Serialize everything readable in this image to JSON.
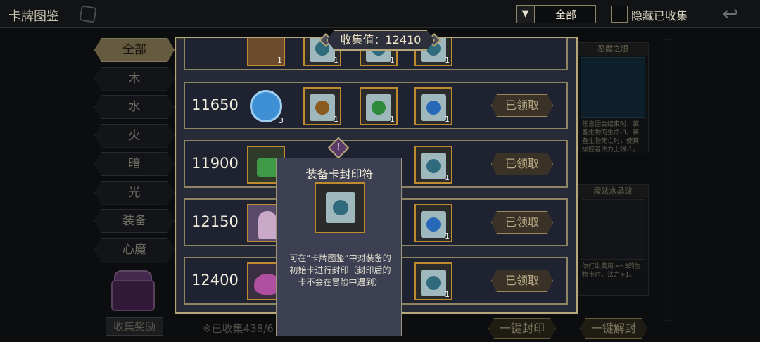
{
  "header": {
    "title": "卡牌图鉴",
    "filter_value": "全部",
    "hide_collected_label": "隐藏已收集"
  },
  "tabs": [
    "全部",
    "木",
    "水",
    "火",
    "暗",
    "光",
    "装备",
    "心魔"
  ],
  "sidebar": {
    "collect_reward_label": "收集奖励",
    "collected_text": "※已收集438/6"
  },
  "cards": [
    {
      "title": "恶魔之眼",
      "desc": "任意回合结束时：装备生物的生命-3。装备生物死亡时，使其操控者法力上限-1。"
    },
    {
      "title": "魔法水晶球",
      "desc": "你打出费用>=3的生物卡时，法力+1。"
    }
  ],
  "bottom_buttons": {
    "seal_all": "一键封印",
    "unseal_all": "一键解封"
  },
  "modal": {
    "collect_value_label": "收集值：12410",
    "rows": [
      {
        "threshold": "11650",
        "claim": "已领取",
        "counts": [
          "3",
          "1",
          "1",
          "1"
        ]
      },
      {
        "threshold": "11900",
        "claim": "已领取",
        "counts": [
          "",
          "",
          "",
          "1"
        ]
      },
      {
        "threshold": "12150",
        "claim": "已领取",
        "counts": [
          "",
          "",
          "",
          "1"
        ]
      },
      {
        "threshold": "12400",
        "claim": "已领取",
        "counts": [
          "",
          "",
          "",
          "1"
        ]
      }
    ],
    "top_row_counts": [
      "1",
      "1",
      "1",
      "1"
    ]
  },
  "tooltip": {
    "title": "装备卡封印符",
    "description": "可在“卡牌图鉴”中对装备的初始卡进行封印（封印后的卡不会在冒险中遇到）",
    "marker": "!"
  },
  "colors": {
    "gold": "#b6a77a",
    "panel": "#272a37",
    "row": "#1f2230"
  }
}
